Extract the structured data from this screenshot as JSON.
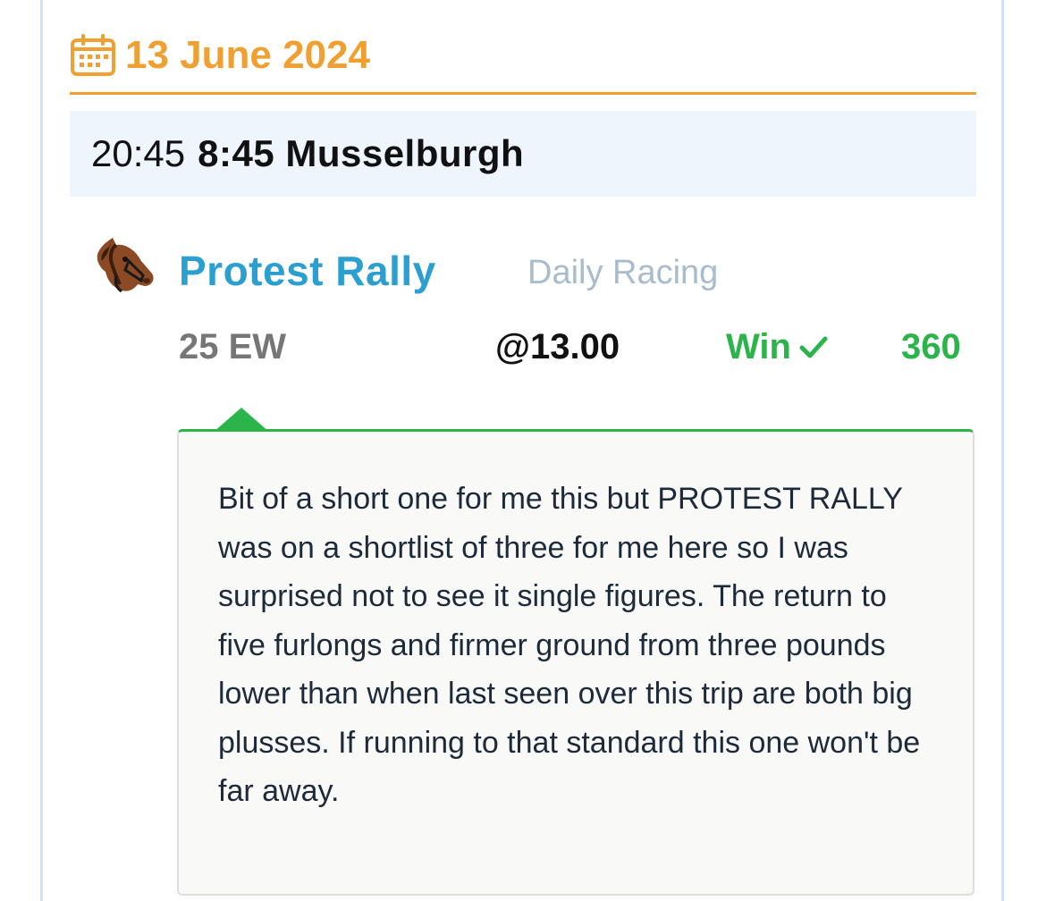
{
  "card": {
    "date_icon": "calendar-icon",
    "date": "13 June 2024",
    "race_time_24h": "20:45",
    "race_name": "8:45 Musselburgh",
    "selection": {
      "icon": "horse-head-icon",
      "horse_name": "Protest Rally",
      "tipster": "Daily Racing",
      "stake": "25 EW",
      "odds": "@13.00",
      "result": "Win",
      "result_icon": "check-icon",
      "returns": "360"
    },
    "comment": "Bit of a short one for me this but PROTEST RALLY was on a shortlist of three for me here so I was surprised not to see it single figures. The return to five furlongs and firmer ground from three pounds lower than when last seen over this trip are both big plusses. If running to that standard this one won't be far away."
  },
  "colors": {
    "accent_orange": "#f0a030",
    "horse_link_blue": "#2a9fd0",
    "win_green": "#2bb44a",
    "race_row_bg": "#eef5fc",
    "tipster_grey": "#a8bccc"
  }
}
